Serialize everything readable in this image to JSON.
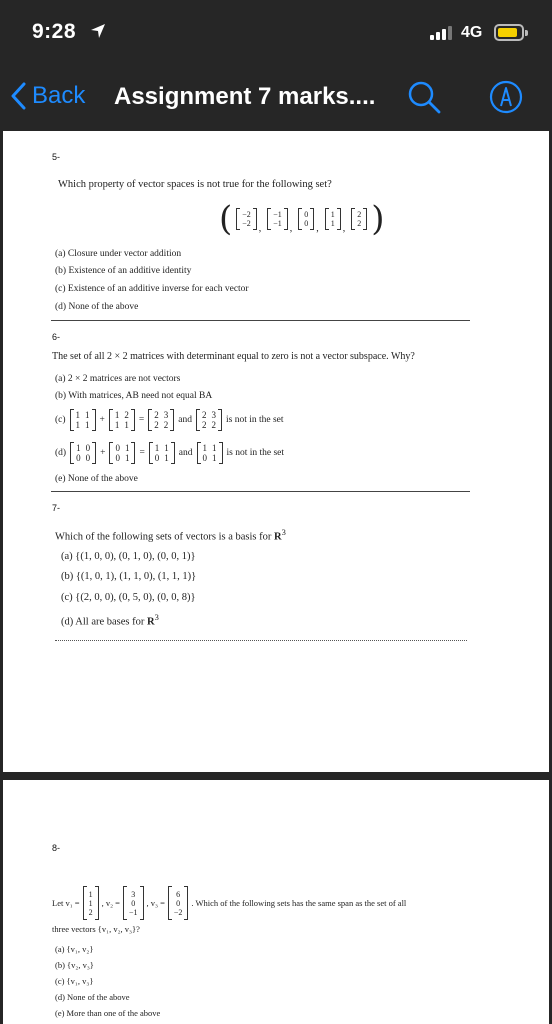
{
  "status_bar": {
    "time": "9:28",
    "network": "4G"
  },
  "nav": {
    "back_label": "Back",
    "title": "Assignment 7 marks...."
  },
  "q5": {
    "number": "5-",
    "stem": "Which property of vector spaces is not true for the following set?",
    "vectors": [
      [
        "−2",
        "−2"
      ],
      [
        "−1",
        "−1"
      ],
      [
        "0",
        "0"
      ],
      [
        "1",
        "1"
      ],
      [
        "2",
        "2"
      ]
    ],
    "options": [
      "(a) Closure under vector addition",
      "(b) Existence of an additive identity",
      "(c) Existence of an additive inverse for each vector",
      "(d) None of the above"
    ]
  },
  "q6": {
    "number": "6-",
    "stem": "The set of all 2 × 2 matrices with determinant equal to zero is not a vector subspace. Why?",
    "option_a": "(a) 2 × 2 matrices are not vectors",
    "option_b": "(b) With matrices, AB need not equal BA",
    "option_c": {
      "label": "(c)",
      "m1": [
        "1",
        "1",
        "1",
        "1"
      ],
      "m2": [
        "1",
        "2",
        "1",
        "1"
      ],
      "m3": [
        "2",
        "3",
        "2",
        "2"
      ],
      "and": "and",
      "m4": [
        "2",
        "3",
        "2",
        "2"
      ],
      "tail": "is not in the set"
    },
    "option_d": {
      "label": "(d)",
      "m1": [
        "1",
        "0",
        "0",
        "0"
      ],
      "m2": [
        "0",
        "1",
        "0",
        "1"
      ],
      "m3": [
        "1",
        "1",
        "0",
        "1"
      ],
      "and": "and",
      "m4": [
        "1",
        "1",
        "0",
        "1"
      ],
      "tail": "is not in the set"
    },
    "option_e": "(e) None of the above"
  },
  "q7": {
    "number": "7-",
    "stem_prefix": "Which of the following sets of vectors is a basis for ",
    "stem_R": "R",
    "stem_exp": "3",
    "options": [
      "(a) {(1, 0, 0), (0, 1, 0), (0, 0, 1)}",
      "(b) {(1, 0, 1), (1, 1, 0), (1, 1, 1)}",
      "(c) {(2, 0, 0), (0, 5, 0), (0, 0, 8)}"
    ],
    "option_d_prefix": "(d) All are bases for ",
    "option_d_R": "R",
    "option_d_exp": "3"
  },
  "q8": {
    "number": "8-",
    "let": "Let v₁ =",
    "v1": [
      "1",
      "1",
      "2"
    ],
    "v2_label": ", v₂ =",
    "v2": [
      "3",
      "0",
      "−1"
    ],
    "v3_label": ", v₃ =",
    "v3": [
      "6",
      "0",
      "−2"
    ],
    "stem_tail": ". Which of the following sets has the same span as the set of all",
    "stem_line2": "three vectors {v₁, v₂, v₃}?",
    "options": [
      "(a) {v₁, v₂}",
      "(b) {v₂, v₃}",
      "(c) {v₁, v₃}",
      "(d) None of the above",
      "(e) More than one of the above"
    ]
  },
  "colors": {
    "accent": "#1e8bff",
    "bar": "#262626",
    "battery": "#f5d000"
  },
  "icons": [
    "location-arrow-icon",
    "signal-icon",
    "battery-icon",
    "chevron-left-icon",
    "search-icon",
    "markup-pen-icon"
  ]
}
